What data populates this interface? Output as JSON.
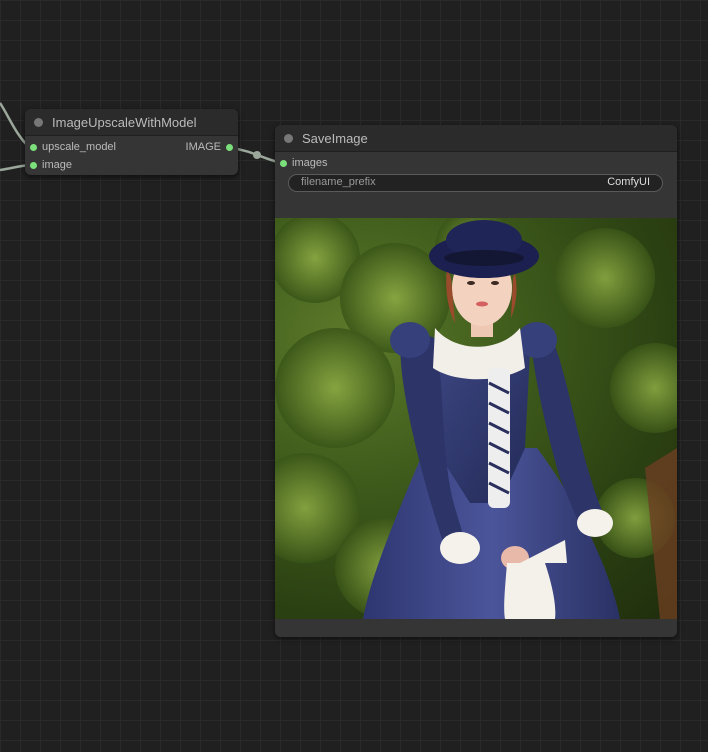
{
  "nodes": {
    "upscale": {
      "title": "ImageUpscaleWithModel",
      "inputs": [
        {
          "label": "upscale_model"
        },
        {
          "label": "image"
        }
      ],
      "outputs": [
        {
          "label": "IMAGE"
        }
      ]
    },
    "save": {
      "title": "SaveImage",
      "inputs": [
        {
          "label": "images"
        }
      ],
      "widget": {
        "label": "filename_prefix",
        "value": "ComfyUI"
      }
    }
  },
  "colors": {
    "canvas_bg": "#202020",
    "node_bg": "#353535",
    "slot_image": "#7be07b",
    "link": "#9aa79a"
  },
  "preview": {
    "alt": "Generated image of a young woman in a navy Victorian dress and black hat against green foliage"
  }
}
